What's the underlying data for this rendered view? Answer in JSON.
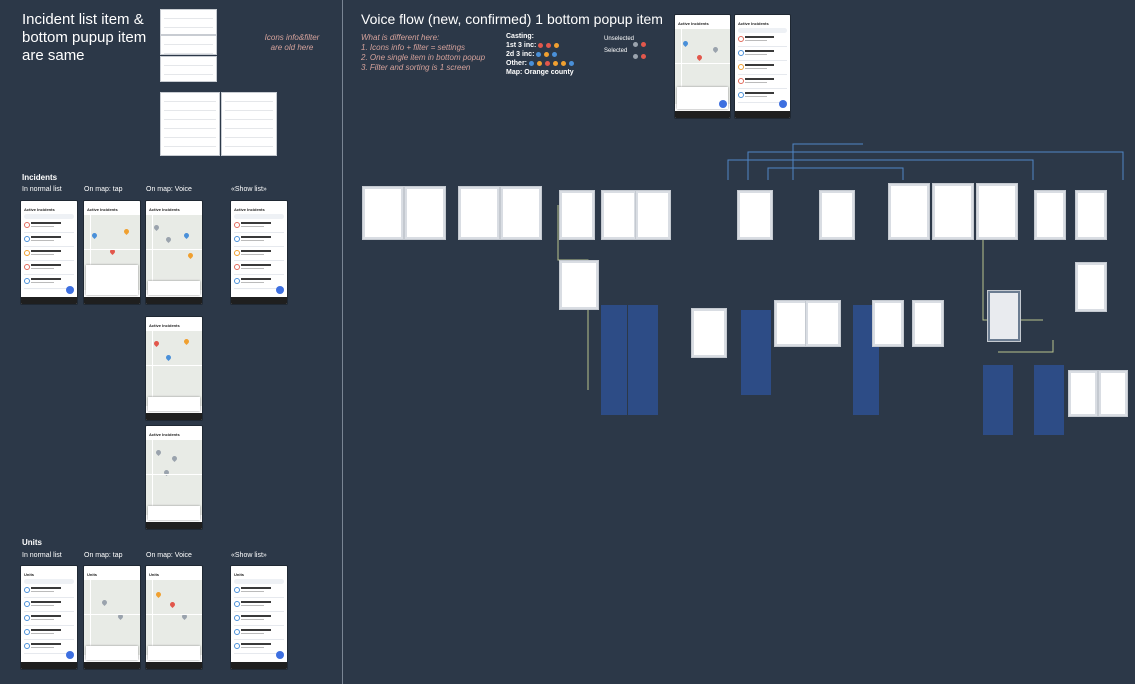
{
  "left": {
    "title": "Incident list item & bottom pupup item are same",
    "note": "Icons info&filter are old here",
    "incidents_heading": "Incidents",
    "units_heading": "Units",
    "col_labels": [
      "In normal list",
      "On map: tap",
      "On map: Voice",
      "«Show list»"
    ],
    "phone_title_incidents": "Active Incidents",
    "phone_title_units": "Units"
  },
  "right": {
    "title": "Voice flow (new, confirmed) 1 bottom popup item",
    "diff_heading": "What is different here:",
    "diff_items": [
      "1. Icons info + filter = settings",
      "2. One single item in bottom popup",
      "3. Filter and sorting is 1 screen"
    ],
    "casting": {
      "heading": "Casting:",
      "rows": [
        "1st 3 inc:",
        "2d 3 inc:",
        "Other:"
      ],
      "map": "Map: Orange county"
    },
    "states": {
      "unselected": "Unselected",
      "selected": "Selected"
    },
    "phone_title": "Active Incidents"
  },
  "colors": {
    "background": "#2c3848",
    "accent_blue": "#3d6fe0",
    "pin_red": "#e2574c",
    "pin_blue": "#4a90d9",
    "pin_orange": "#f0a030",
    "note_color": "#d6a39c"
  }
}
